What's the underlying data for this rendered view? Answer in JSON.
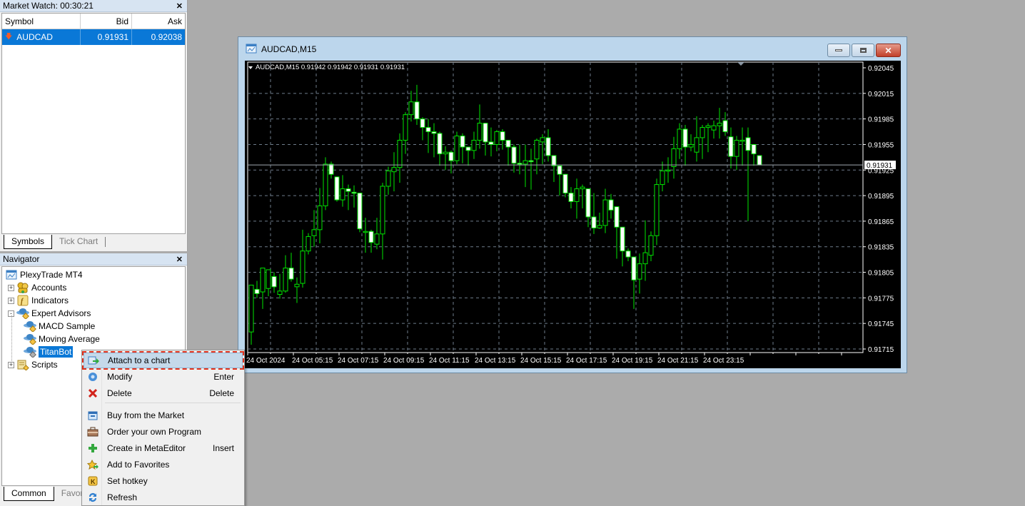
{
  "market_watch": {
    "title": "Market Watch: 00:30:21",
    "columns": [
      "Symbol",
      "Bid",
      "Ask"
    ],
    "rows": [
      {
        "symbol": "AUDCAD",
        "bid": "0.91931",
        "ask": "0.92038",
        "direction": "down-arrow-icon"
      }
    ],
    "tabs": [
      "Symbols",
      "Tick Chart"
    ]
  },
  "navigator": {
    "title": "Navigator",
    "root": "PlexyTrade MT4",
    "items": [
      {
        "label": "Accounts",
        "icon": "accounts-icon",
        "expand": "+"
      },
      {
        "label": "Indicators",
        "icon": "indicators-icon",
        "expand": "+"
      },
      {
        "label": "Expert Advisors",
        "icon": "expert-advisor-icon",
        "expand": "-"
      },
      {
        "label": "MACD Sample",
        "icon": "expert-advisor-icon"
      },
      {
        "label": "Moving Average",
        "icon": "expert-advisor-icon"
      },
      {
        "label": "TitanBot",
        "icon": "expert-advisor-icon",
        "selected": true
      },
      {
        "label": "Scripts",
        "icon": "scripts-icon",
        "expand": "+"
      }
    ],
    "tabs": [
      "Common",
      "Favorites"
    ]
  },
  "chart_window": {
    "title": "AUDCAD,M15",
    "info_line": "AUDCAD,M15  0.91942 0.91942 0.91931 0.91931",
    "current_price": "0.91931"
  },
  "context_menu": {
    "items": [
      {
        "label": "Attach to a chart",
        "shortcut": "",
        "icon": "attach-chart-icon",
        "highlighted": true
      },
      {
        "label": "Modify",
        "shortcut": "Enter",
        "icon": "gear-icon"
      },
      {
        "label": "Delete",
        "shortcut": "Delete",
        "icon": "delete-icon"
      },
      {
        "label": "Buy from the Market",
        "shortcut": "",
        "icon": "market-icon"
      },
      {
        "label": "Order your own Program",
        "shortcut": "",
        "icon": "briefcase-icon"
      },
      {
        "label": "Create in MetaEditor",
        "shortcut": "Insert",
        "icon": "plus-icon"
      },
      {
        "label": "Add to Favorites",
        "shortcut": "",
        "icon": "favorites-star-icon"
      },
      {
        "label": "Set hotkey",
        "shortcut": "",
        "icon": "hotkey-icon"
      },
      {
        "label": "Refresh",
        "shortcut": "",
        "icon": "refresh-icon"
      }
    ]
  },
  "chart_data": {
    "type": "candlestick",
    "title": "AUDCAD,M15",
    "ylim": [
      0.91705,
      0.92055
    ],
    "y_ticks": [
      "0.92045",
      "0.92015",
      "0.91985",
      "0.91955",
      "0.91925",
      "0.91895",
      "0.91865",
      "0.91835",
      "0.91805",
      "0.91775",
      "0.91745",
      "0.91715"
    ],
    "x_ticks": [
      "24 Oct 2024",
      "24 Oct 05:15",
      "24 Oct 07:15",
      "24 Oct 09:15",
      "24 Oct 11:15",
      "24 Oct 13:15",
      "24 Oct 15:15",
      "24 Oct 17:15",
      "24 Oct 19:15",
      "24 Oct 21:15",
      "24 Oct 23:15"
    ],
    "current_price": 0.91931,
    "candles": [
      [
        0.91735,
        0.9179,
        0.9172,
        0.9179
      ],
      [
        0.91785,
        0.9178,
        0.91795,
        0.91775
      ],
      [
        0.91782,
        0.9181,
        0.91762,
        0.91786
      ],
      [
        0.91786,
        0.91808,
        0.91777,
        0.918
      ],
      [
        0.918,
        0.91788,
        0.91805,
        0.91781
      ],
      [
        0.91779,
        0.91783,
        0.91803,
        0.91774
      ],
      [
        0.91783,
        0.9181,
        0.91825,
        0.91781
      ],
      [
        0.9181,
        0.91797,
        0.91828,
        0.91794
      ],
      [
        0.91788,
        0.91791,
        0.91799,
        0.91769
      ],
      [
        0.91792,
        0.9183,
        0.91855,
        0.91787
      ],
      [
        0.9183,
        0.91847,
        0.91851,
        0.91826
      ],
      [
        0.91848,
        0.91855,
        0.91878,
        0.91835
      ],
      [
        0.91855,
        0.91883,
        0.91904,
        0.91839
      ],
      [
        0.91883,
        0.91932,
        0.9194,
        0.91878
      ],
      [
        0.91932,
        0.9192,
        0.91935,
        0.91915
      ],
      [
        0.91917,
        0.9189,
        0.91913,
        0.91888
      ],
      [
        0.9189,
        0.91903,
        0.91919,
        0.91882
      ],
      [
        0.91903,
        0.919,
        0.91908,
        0.91878
      ],
      [
        0.91899,
        0.91898,
        0.91907,
        0.91881
      ],
      [
        0.91898,
        0.91856,
        0.91898,
        0.91852
      ],
      [
        0.91852,
        0.91853,
        0.91869,
        0.91828
      ],
      [
        0.91853,
        0.9184,
        0.91855,
        0.91828
      ],
      [
        0.91838,
        0.9185,
        0.91869,
        0.91832
      ],
      [
        0.9185,
        0.91906,
        0.9191,
        0.9182
      ],
      [
        0.91906,
        0.91924,
        0.91929,
        0.91896
      ],
      [
        0.91923,
        0.91928,
        0.91946,
        0.919
      ],
      [
        0.91928,
        0.9196,
        0.91968,
        0.9191
      ],
      [
        0.9196,
        0.9199,
        0.91993,
        0.91944
      ],
      [
        0.9199,
        0.92005,
        0.92018,
        0.91982
      ],
      [
        0.92005,
        0.91985,
        0.92025,
        0.91978
      ],
      [
        0.91985,
        0.91975,
        0.91987,
        0.9196
      ],
      [
        0.91975,
        0.9197,
        0.91985,
        0.91945
      ],
      [
        0.9197,
        0.91968,
        0.9198,
        0.9194
      ],
      [
        0.91968,
        0.91944,
        0.9197,
        0.9193
      ],
      [
        0.91944,
        0.91946,
        0.91953,
        0.91925
      ],
      [
        0.91946,
        0.91936,
        0.91948,
        0.91921
      ],
      [
        0.91936,
        0.91965,
        0.9197,
        0.91932
      ],
      [
        0.91965,
        0.91952,
        0.91968,
        0.91933
      ],
      [
        0.91952,
        0.91948,
        0.91952,
        0.9193
      ],
      [
        0.91948,
        0.9196,
        0.9197,
        0.91938
      ],
      [
        0.9196,
        0.9198,
        0.92002,
        0.9195
      ],
      [
        0.9198,
        0.91958,
        0.91978,
        0.91942
      ],
      [
        0.91958,
        0.91955,
        0.91975,
        0.91941
      ],
      [
        0.91955,
        0.9197,
        0.91972,
        0.91947
      ],
      [
        0.9197,
        0.9196,
        0.91973,
        0.91949
      ],
      [
        0.9196,
        0.91952,
        0.9196,
        0.9193
      ],
      [
        0.91952,
        0.91933,
        0.91955,
        0.91922
      ],
      [
        0.91933,
        0.91932,
        0.91955,
        0.9192
      ],
      [
        0.91932,
        0.91936,
        0.91955,
        0.91905
      ],
      [
        0.91936,
        0.91935,
        0.9195,
        0.91902
      ],
      [
        0.91938,
        0.9196,
        0.91962,
        0.9192
      ],
      [
        0.91958,
        0.91963,
        0.91967,
        0.91932
      ],
      [
        0.91963,
        0.91942,
        0.91973,
        0.91935
      ],
      [
        0.91942,
        0.9193,
        0.91942,
        0.91911
      ],
      [
        0.9193,
        0.9192,
        0.91927,
        0.91895
      ],
      [
        0.9192,
        0.91898,
        0.91918,
        0.91893
      ],
      [
        0.91898,
        0.91888,
        0.91905,
        0.9188
      ],
      [
        0.91888,
        0.91903,
        0.91915,
        0.91868
      ],
      [
        0.91903,
        0.91905,
        0.91908,
        0.9188
      ],
      [
        0.91903,
        0.9187,
        0.91903,
        0.91858
      ],
      [
        0.9187,
        0.91857,
        0.91898,
        0.9185
      ],
      [
        0.91857,
        0.9186,
        0.91875,
        0.91856
      ],
      [
        0.9186,
        0.9189,
        0.91903,
        0.91851
      ],
      [
        0.9189,
        0.91878,
        0.91897,
        0.91868
      ],
      [
        0.91882,
        0.91858,
        0.91872,
        0.91821
      ],
      [
        0.91858,
        0.9183,
        0.91845,
        0.91812
      ],
      [
        0.9183,
        0.91823,
        0.91833,
        0.91818
      ],
      [
        0.91823,
        0.91796,
        0.91822,
        0.91762
      ],
      [
        0.91797,
        0.91815,
        0.91827,
        0.9178
      ],
      [
        0.91815,
        0.91828,
        0.91866,
        0.91795
      ],
      [
        0.91825,
        0.91848,
        0.91853,
        0.91818
      ],
      [
        0.91848,
        0.91908,
        0.91915,
        0.91837
      ],
      [
        0.91908,
        0.91924,
        0.91935,
        0.919
      ],
      [
        0.91925,
        0.91925,
        0.9194,
        0.9191
      ],
      [
        0.91929,
        0.9195,
        0.91964,
        0.91915
      ],
      [
        0.9195,
        0.91973,
        0.9198,
        0.91938
      ],
      [
        0.91973,
        0.91952,
        0.91978,
        0.9193
      ],
      [
        0.91952,
        0.91955,
        0.91967,
        0.91947
      ],
      [
        0.91946,
        0.91963,
        0.91988,
        0.91935
      ],
      [
        0.91963,
        0.91975,
        0.91978,
        0.91938
      ],
      [
        0.91975,
        0.91977,
        0.9198,
        0.91946
      ],
      [
        0.91972,
        0.91977,
        0.91983,
        0.91962
      ],
      [
        0.91977,
        0.9198,
        0.91998,
        0.91962
      ],
      [
        0.91983,
        0.9197,
        0.91993,
        0.91965
      ],
      [
        0.91964,
        0.91941,
        0.91975,
        0.91927
      ],
      [
        0.91941,
        0.9196,
        0.91965,
        0.91925
      ],
      [
        0.9196,
        0.9196,
        0.91975,
        0.9193
      ],
      [
        0.91963,
        0.91948,
        0.91975,
        0.91865
      ],
      [
        0.91955,
        0.91944,
        0.91955,
        0.9193
      ],
      [
        0.91942,
        0.91931,
        0.91942,
        0.91931
      ]
    ]
  }
}
